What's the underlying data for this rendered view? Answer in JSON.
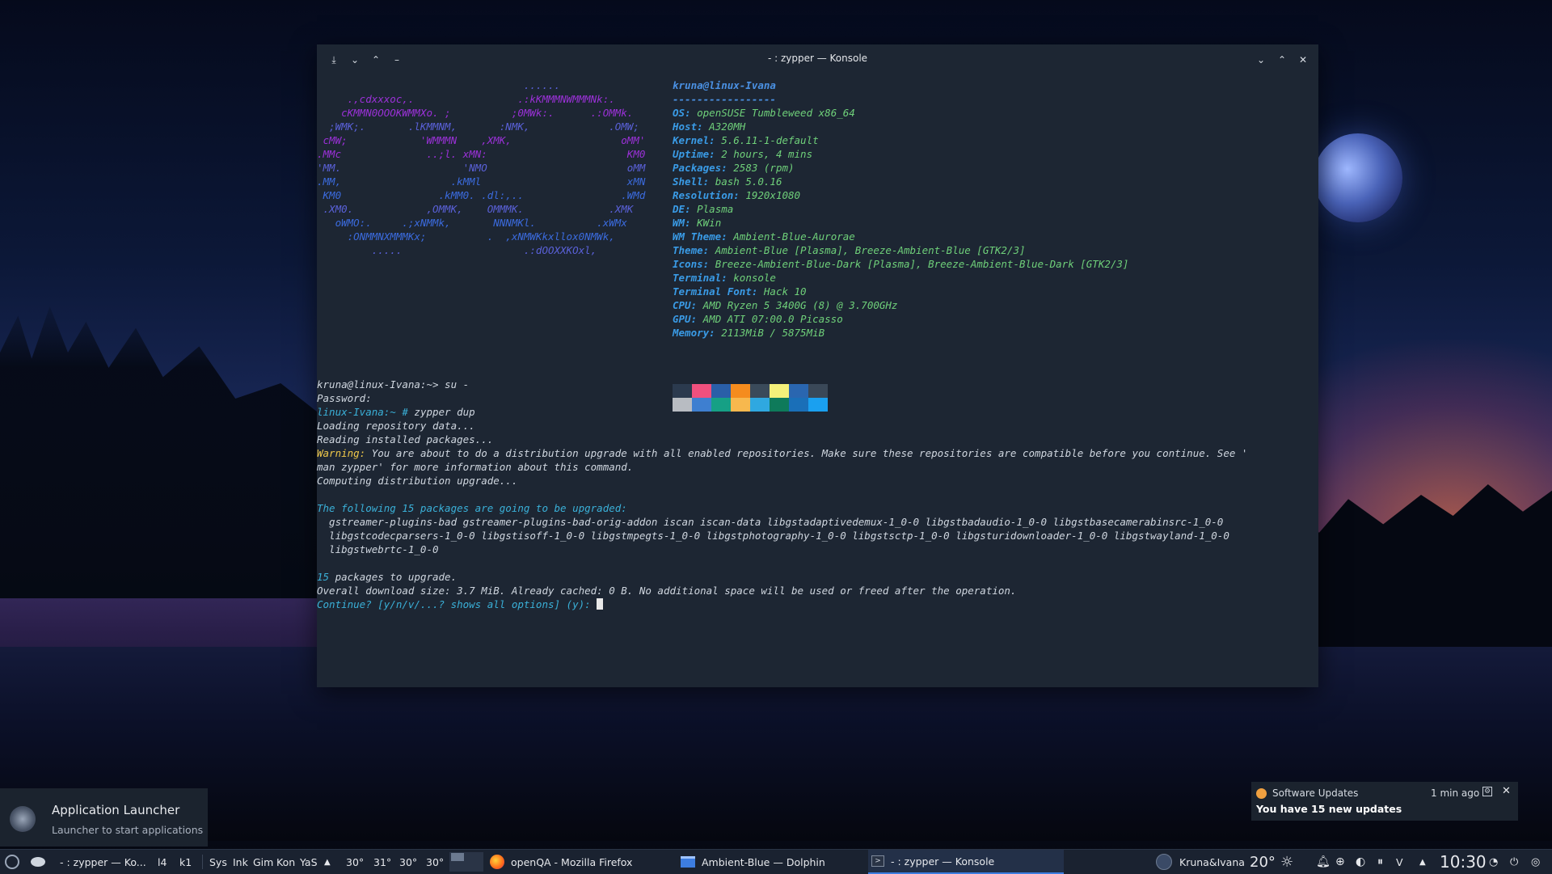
{
  "window": {
    "title": "- : zypper — Konsole"
  },
  "neofetch": {
    "logo": [
      "                                  ......",
      "     .,cdxxxoc,.                 .:kKMMMNWMMMNk:.",
      "    cKMMN0OOOKWMMXo. ;          ;0MWk:.      .:OMMk.",
      "  ;WMK;.       .lKMMNM,       :NMK,             .OMW;",
      " cMW;            'WMMMN    ,XMK,                  oMM'",
      ".MMc              ..;l. xMN:                       KM0",
      "'MM.                    'NMO                       oMM",
      ".MM,                  .kMMl                        xMN",
      " KM0                .kMM0. .dl:,..                .WMd",
      " .XM0.            ,OMMK,    OMMMK.              .XMK",
      "   oWMO:.     .;xNMMk,       NNNMKl.          .xWMx",
      "     :ONMMNXMMMKx;          .  ,xNMWKkxllox0NMWk,",
      "         .....                    .:dOOXXKOxl,"
    ],
    "user_host": "kruna@linux-Ivana",
    "separator": "-----------------",
    "info": [
      {
        "key": "OS",
        "value": "openSUSE Tumbleweed x86_64"
      },
      {
        "key": "Host",
        "value": "A320MH"
      },
      {
        "key": "Kernel",
        "value": "5.6.11-1-default"
      },
      {
        "key": "Uptime",
        "value": "2 hours, 4 mins"
      },
      {
        "key": "Packages",
        "value": "2583 (rpm)"
      },
      {
        "key": "Shell",
        "value": "bash 5.0.16"
      },
      {
        "key": "Resolution",
        "value": "1920x1080"
      },
      {
        "key": "DE",
        "value": "Plasma"
      },
      {
        "key": "WM",
        "value": "KWin"
      },
      {
        "key": "WM Theme",
        "value": "Ambient-Blue-Aurorae"
      },
      {
        "key": "Theme",
        "value": "Ambient-Blue [Plasma], Breeze-Ambient-Blue [GTK2/3]"
      },
      {
        "key": "Icons",
        "value": "Breeze-Ambient-Blue-Dark [Plasma], Breeze-Ambient-Blue-Dark [GTK2/3]"
      },
      {
        "key": "Terminal",
        "value": "konsole"
      },
      {
        "key": "Terminal Font",
        "value": "Hack 10"
      },
      {
        "key": "CPU",
        "value": "AMD Ryzen 5 3400G (8) @ 3.700GHz"
      },
      {
        "key": "GPU",
        "value": "AMD ATI 07:00.0 Picasso"
      },
      {
        "key": "Memory",
        "value": "2113MiB / 5875MiB"
      }
    ],
    "palette_row1": [
      "#2b3a4e",
      "#f0507e",
      "#2a5fa8",
      "#f58c1e",
      "#3a4a5a",
      "#f4f07a",
      "#2a66b0",
      "#3a4858"
    ],
    "palette_row2": [
      "#b8bcc2",
      "#3e7fd0",
      "#16a085",
      "#f7b84e",
      "#2fa8e0",
      "#0e7a5a",
      "#1a6fb8",
      "#1aa0f0"
    ]
  },
  "session": {
    "prompt_user": "kruna@linux-Ivana:~>",
    "cmd_su": " su -",
    "password": "Password:",
    "root_prompt": "linux-Ivana:~ #",
    "cmd_zypper": " zypper dup",
    "loading": "Loading repository data...",
    "reading": "Reading installed packages...",
    "warning_label": "Warning:",
    "warning_text_1": " You are about to do a distribution upgrade with all enabled repositories. Make sure these repositories are compatible before you continue. See '",
    "warning_text_2": "man zypper' for more information about this command.",
    "computing": "Computing distribution upgrade...",
    "following": "The following 15 packages are going to be upgraded:",
    "pkg_line_1": "  gstreamer-plugins-bad gstreamer-plugins-bad-orig-addon iscan iscan-data libgstadaptivedemux-1_0-0 libgstbadaudio-1_0-0 libgstbasecamerabinsrc-1_0-0",
    "pkg_line_2": "  libgstcodecparsers-1_0-0 libgstisoff-1_0-0 libgstmpegts-1_0-0 libgstphotography-1_0-0 libgstsctp-1_0-0 libgsturidownloader-1_0-0 libgstwayland-1_0-0",
    "pkg_line_3": "  libgstwebrtc-1_0-0",
    "count_num": "15",
    "count_text": " packages to upgrade.",
    "download": "Overall download size: 3.7 MiB. Already cached: 0 B. No additional space will be used or freed after the operation.",
    "continue": "Continue? [y/n/v/...? shows all options] (y): "
  },
  "launcher_tooltip": {
    "title": "Application Launcher",
    "subtitle": "Launcher to start applications"
  },
  "software_notification": {
    "title": "Software Updates",
    "time": "1 min ago",
    "body": "You have 15 new updates"
  },
  "panel": {
    "task_zypper_small": "- : zypper — Ko...",
    "pager_1": "l4",
    "pager_2": "k1",
    "quick_1": "Sys",
    "quick_2": "Ink",
    "quick_3": "Gim",
    "quick_4": "Kon",
    "quick_5": "YaS",
    "temp_1": "30°",
    "temp_2": "31°",
    "temp_3": "30°",
    "temp_4": "30°",
    "task_firefox": "openQA - Mozilla Firefox",
    "task_dolphin": "Ambient-Blue — Dolphin",
    "task_konsole": "- : zypper — Konsole",
    "user": "Kruna&Ivana",
    "weather_temp": "20°",
    "clock": "10:30",
    "tray_text": "V"
  },
  "colors": {
    "accent": "#3d7de0",
    "warning": "#f0c94a",
    "value_green": "#6fd07a",
    "key_blue": "#3a9be6"
  }
}
